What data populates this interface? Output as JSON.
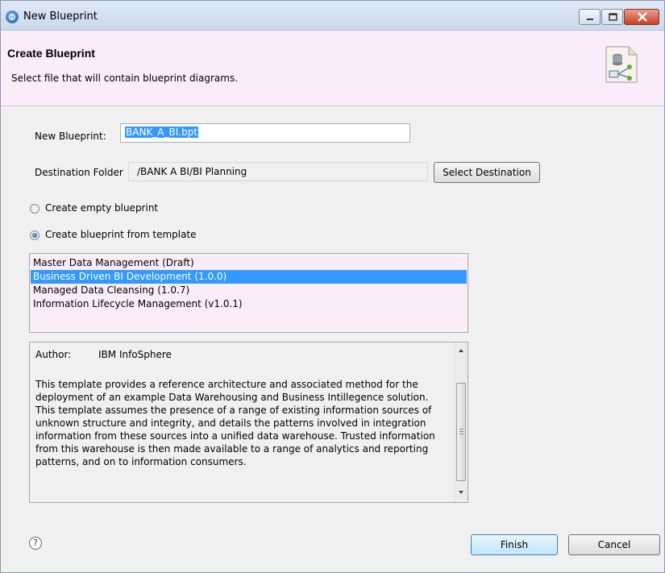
{
  "window": {
    "title": "New Blueprint"
  },
  "banner": {
    "title": "Create Blueprint",
    "subtitle": "Select file that will contain blueprint diagrams."
  },
  "form": {
    "new_blueprint_label": "New Blueprint:",
    "new_blueprint_value": "BANK_A_BI.bpt",
    "destination_label": "Destination Folder",
    "destination_value": "/BANK A BI/BI Planning",
    "select_destination_label": "Select Destination",
    "radio_empty_label": "Create empty blueprint",
    "radio_template_label": "Create blueprint from template",
    "selected_radio": "template"
  },
  "templates": {
    "items": [
      "Master Data Management (Draft)",
      "Business Driven BI Development (1.0.0)",
      "Managed Data Cleansing (1.0.7)",
      "Information Lifecycle Management (v1.0.1)"
    ],
    "selected_index": 1
  },
  "description": {
    "author_label": "Author:",
    "author_value": "IBM InfoSphere",
    "body": "This template provides a reference architecture and associated method for the deployment of an example Data Warehousing and Business Intillegence solution. This template assumes the presence of a range of existing information sources of unknown structure and integrity, and details the patterns involved in integration information from these sources into a unified data warehouse. Trusted information from this warehouse is then made available to a range of analytics and reporting patterns, and on to information consumers."
  },
  "footer": {
    "help_icon": "help-icon",
    "finish_label": "Finish",
    "cancel_label": "Cancel"
  },
  "colors": {
    "banner_bg": "#fbecf9",
    "selection": "#3399ff"
  }
}
